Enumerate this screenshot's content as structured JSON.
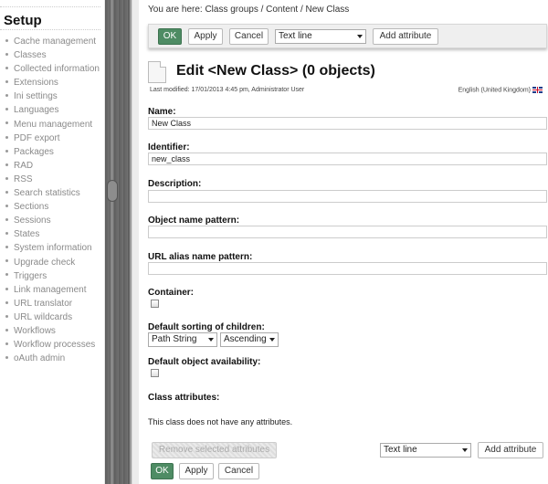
{
  "sidebar": {
    "title": "Setup",
    "items": [
      "Cache management",
      "Classes",
      "Collected information",
      "Extensions",
      "Ini settings",
      "Languages",
      "Menu management",
      "PDF export",
      "Packages",
      "RAD",
      "RSS",
      "Search statistics",
      "Sections",
      "Sessions",
      "States",
      "System information",
      "Upgrade check",
      "Triggers",
      "Link management",
      "URL translator",
      "URL wildcards",
      "Workflows",
      "Workflow processes",
      "oAuth admin"
    ]
  },
  "breadcrumb": "You are here: Class groups / Content / New Class",
  "toolbar": {
    "ok_label": "OK",
    "apply_label": "Apply",
    "cancel_label": "Cancel",
    "datatype_selected": "Text line",
    "add_attribute_label": "Add attribute"
  },
  "header": {
    "title": "Edit <New Class> (0 objects)",
    "last_modified": "Last modified: 17/01/2013 4:45 pm, Administrator User",
    "language": "English (United Kingdom)"
  },
  "form": {
    "name_label": "Name:",
    "name_value": "New Class",
    "identifier_label": "Identifier:",
    "identifier_value": "new_class",
    "description_label": "Description:",
    "description_value": "",
    "object_name_pattern_label": "Object name pattern:",
    "object_name_pattern_value": "",
    "url_alias_label": "URL alias name pattern:",
    "url_alias_value": "",
    "container_label": "Container:",
    "sorting_label": "Default sorting of children:",
    "sort_field": "Path String",
    "sort_order": "Ascending",
    "availability_label": "Default object availability:",
    "class_attributes_label": "Class attributes:",
    "no_attributes_text": "This class does not have any attributes."
  },
  "bottom": {
    "remove_selected_label": "Remove selected attributes",
    "datatype_selected": "Text line",
    "add_attribute_label": "Add attribute",
    "ok_label": "OK",
    "apply_label": "Apply",
    "cancel_label": "Cancel"
  },
  "colors": {
    "ok_button": "#4e8c64",
    "sidebar_text": "#8a8a8a",
    "splitter": "#6b6b6b"
  }
}
